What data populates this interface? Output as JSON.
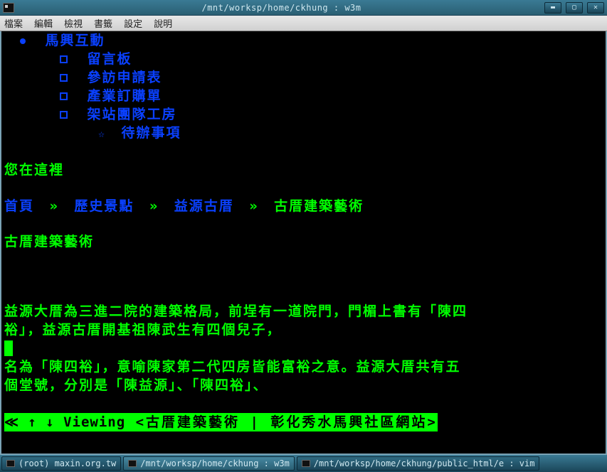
{
  "titlebar": {
    "title": "/mnt/worksp/home/ckhung : w3m"
  },
  "menu": {
    "file": "檔案",
    "edit": "編輯",
    "view": "檢視",
    "bookmarks": "書籤",
    "settings": "設定",
    "help": "說明"
  },
  "nav": {
    "top": "馬興互動",
    "items": [
      "留言板",
      "參訪申請表",
      "產業訂購單",
      "架站團隊工房"
    ],
    "sub": "待辦事項"
  },
  "location_label": "您在這裡",
  "breadcrumb": {
    "home": "首頁",
    "sep": "»",
    "lvl1": "歷史景點",
    "lvl2": "益源古厝",
    "current": "古厝建築藝術"
  },
  "page_title": "古厝建築藝術",
  "body": {
    "line1": "益源大厝為三進二院的建築格局，前埕有一道院門，門楣上書有「陳四",
    "line2": "裕」，益源古厝開基祖陳武生有四個兒子，",
    "line3": "名為「陳四裕」，意喻陳家第二代四房皆能富裕之意。益源大厝共有五",
    "line4": "個堂號，分別是「陳益源」、「陳四裕」、"
  },
  "status": {
    "prefix": "≪ ↑ ↓ ",
    "viewing": "Viewing",
    "doc": " <古厝建築藝術  | 彰化秀水馬興社區網站>"
  },
  "taskbar": {
    "task1": "(root) maxin.org.tw",
    "task2": "/mnt/worksp/home/ckhung : w3m",
    "task3": "/mnt/worksp/home/ckhung/public_html/e : vim"
  }
}
